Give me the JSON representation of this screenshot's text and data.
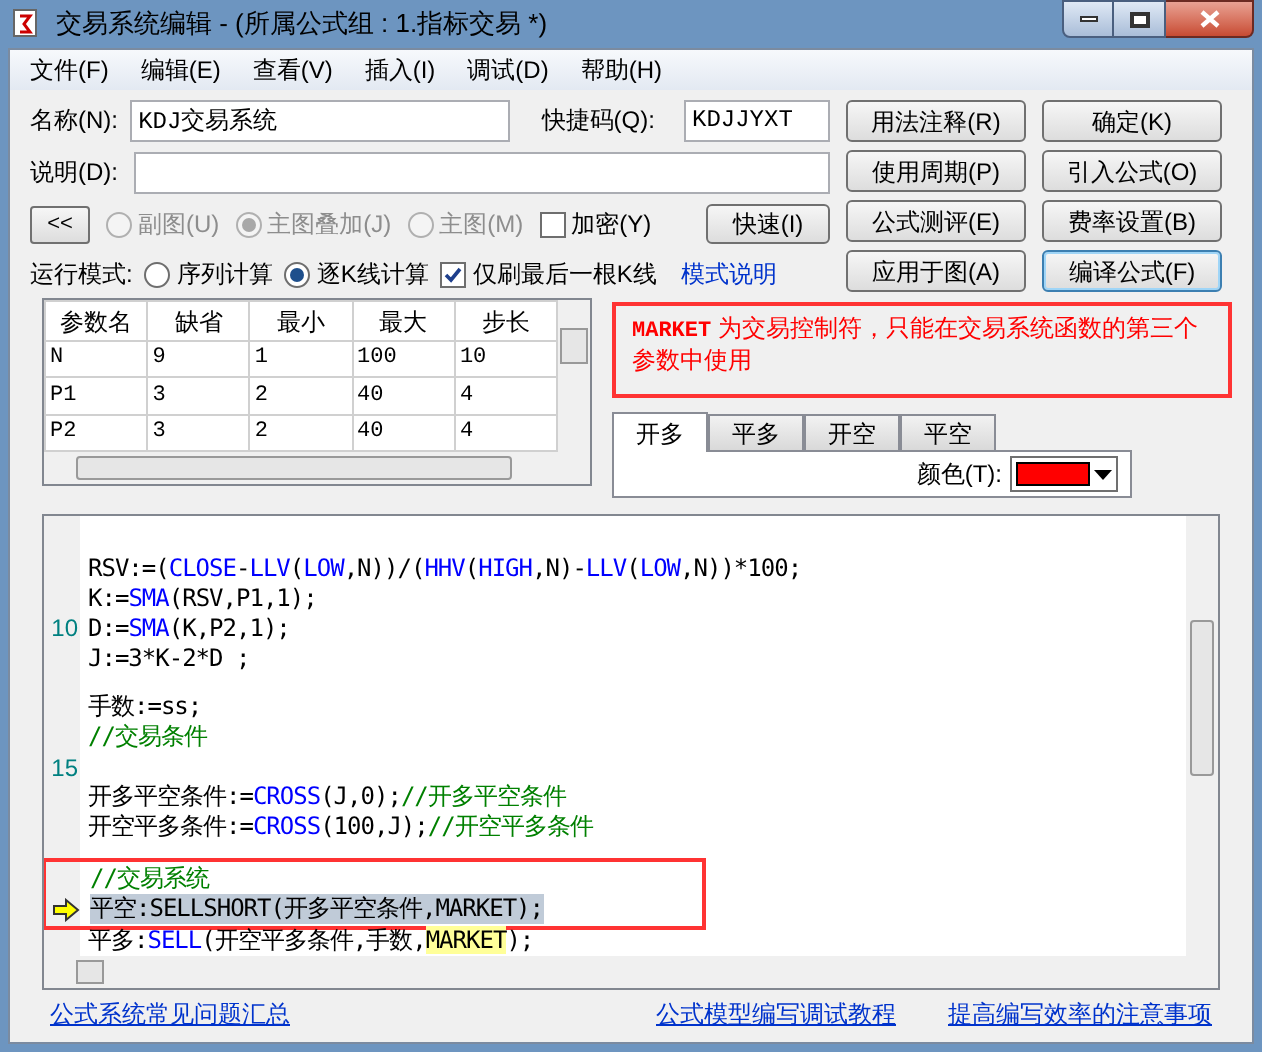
{
  "window": {
    "title": "交易系统编辑 - (所属公式组 : 1.指标交易 *)"
  },
  "menu": [
    "文件(F)",
    "编辑(E)",
    "查看(V)",
    "插入(I)",
    "调试(D)",
    "帮助(H)"
  ],
  "name_field": {
    "label": "名称(N):",
    "value": "KDJ交易系统"
  },
  "shortcut_field": {
    "label": "快捷码(Q):",
    "value": "KDJJYXT"
  },
  "description_field": {
    "label": "说明(D):"
  },
  "collapse_button": "<<",
  "chart_mode": [
    {
      "label": "副图(U)",
      "selected": false,
      "disabled": true
    },
    {
      "label": "主图叠加(J)",
      "selected": true,
      "disabled": true
    },
    {
      "label": "主图(M)",
      "selected": false,
      "disabled": true
    }
  ],
  "encrypt": {
    "label": "加密(Y)",
    "checked": false
  },
  "speed_button": "快速(I)",
  "run_mode": {
    "label": "运行模式:",
    "options": [
      {
        "label": "序列计算",
        "selected": false
      },
      {
        "label": "逐K线计算",
        "selected": true
      }
    ]
  },
  "refresh_last": {
    "label": "仅刷最后一根K线",
    "checked": true
  },
  "mode_link": "模式说明",
  "buttons": [
    {
      "label": "用法注释(R)",
      "default": false
    },
    {
      "label": "确定(K)",
      "default": false
    },
    {
      "label": "使用周期(P)",
      "default": false
    },
    {
      "label": "引入公式(O)",
      "default": false
    },
    {
      "label": "公式测评(E)",
      "default": false
    },
    {
      "label": "费率设置(B)",
      "default": false
    },
    {
      "label": "应用于图(A)",
      "default": false
    },
    {
      "label": "编译公式(F)",
      "default": true
    }
  ],
  "message": {
    "keyword": "MARKET",
    "text": "为交易控制符，只能在交易系统函数的第三个参数中使用"
  },
  "params": {
    "columns": [
      "参数名",
      "缺省",
      "最小",
      "最大",
      "步长"
    ],
    "rows": [
      [
        "N",
        "9",
        "1",
        "100",
        "10"
      ],
      [
        "P1",
        "3",
        "2",
        "40",
        "4"
      ],
      [
        "P2",
        "3",
        "2",
        "40",
        "4"
      ]
    ]
  },
  "signal_tabs": [
    {
      "label": "开多",
      "selected": true
    },
    {
      "label": "平多",
      "selected": false
    },
    {
      "label": "开空",
      "selected": false
    },
    {
      "label": "平空",
      "selected": false
    }
  ],
  "color_field": {
    "label": "颜色(T):",
    "color": "#ff0000"
  },
  "code": [
    {
      "kind": "blank"
    },
    {
      "kind": "code",
      "segments": [
        {
          "kind": "plain",
          "text": "RSV:=("
        },
        {
          "kind": "func",
          "text": "CLOSE"
        },
        {
          "kind": "plain",
          "text": "-"
        },
        {
          "kind": "func",
          "text": "LLV"
        },
        {
          "kind": "plain",
          "text": "("
        },
        {
          "kind": "func",
          "text": "LOW"
        },
        {
          "kind": "plain",
          "text": ",N))/("
        },
        {
          "kind": "func",
          "text": "HHV"
        },
        {
          "kind": "plain",
          "text": "("
        },
        {
          "kind": "func",
          "text": "HIGH"
        },
        {
          "kind": "plain",
          "text": ",N)-"
        },
        {
          "kind": "func",
          "text": "LLV"
        },
        {
          "kind": "plain",
          "text": "("
        },
        {
          "kind": "func",
          "text": "LOW"
        },
        {
          "kind": "plain",
          "text": ",N))*100;"
        }
      ]
    },
    {
      "kind": "code",
      "segments": [
        {
          "kind": "plain",
          "text": "K:="
        },
        {
          "kind": "func",
          "text": "SMA"
        },
        {
          "kind": "plain",
          "text": "(RSV,P1,1);"
        }
      ]
    },
    {
      "kind": "code",
      "number": "10",
      "segments": [
        {
          "kind": "plain",
          "text": "D:="
        },
        {
          "kind": "func",
          "text": "SMA"
        },
        {
          "kind": "plain",
          "text": "(K,P2,1);"
        }
      ]
    },
    {
      "kind": "code",
      "segments": [
        {
          "kind": "plain",
          "text": "J:=3*K-2*D ;"
        }
      ]
    },
    {
      "kind": "blank"
    },
    {
      "kind": "code",
      "segments": [
        {
          "kind": "plain",
          "text": "手数:=ss;"
        }
      ]
    },
    {
      "kind": "code",
      "segments": [
        {
          "kind": "comment",
          "text": "//交易条件"
        }
      ]
    },
    {
      "kind": "blank",
      "number": "15"
    },
    {
      "kind": "code",
      "segments": [
        {
          "kind": "plain",
          "text": "开多平空条件:="
        },
        {
          "kind": "func",
          "text": "CROSS"
        },
        {
          "kind": "plain",
          "text": "(J,0);"
        },
        {
          "kind": "comment",
          "text": "//开多平空条件"
        }
      ]
    },
    {
      "kind": "code",
      "segments": [
        {
          "kind": "plain",
          "text": "开空平多条件:="
        },
        {
          "kind": "func",
          "text": "CROSS"
        },
        {
          "kind": "plain",
          "text": "(100,J);"
        },
        {
          "kind": "comment",
          "text": "//开空平多条件"
        }
      ]
    },
    {
      "kind": "blank"
    },
    {
      "kind": "code",
      "boxed": true,
      "segments": [
        {
          "kind": "comment",
          "text": "//交易系统"
        }
      ]
    },
    {
      "kind": "code",
      "boxed": true,
      "current": true,
      "segments": [
        {
          "kind": "plain",
          "text": "平空:SELLSHORT(开多平空条件,MARKET);"
        }
      ]
    },
    {
      "kind": "code",
      "segments": [
        {
          "kind": "plain",
          "text": "平多:"
        },
        {
          "kind": "func",
          "text": "SELL"
        },
        {
          "kind": "plain",
          "text": "(开空平多条件,手数,"
        },
        {
          "kind": "mark",
          "text": "MARKET"
        },
        {
          "kind": "plain",
          "text": ");"
        }
      ]
    }
  ],
  "footer_links": [
    "公式系统常见问题汇总",
    "公式模型编写调试教程",
    "提高编写效率的注意事项"
  ]
}
